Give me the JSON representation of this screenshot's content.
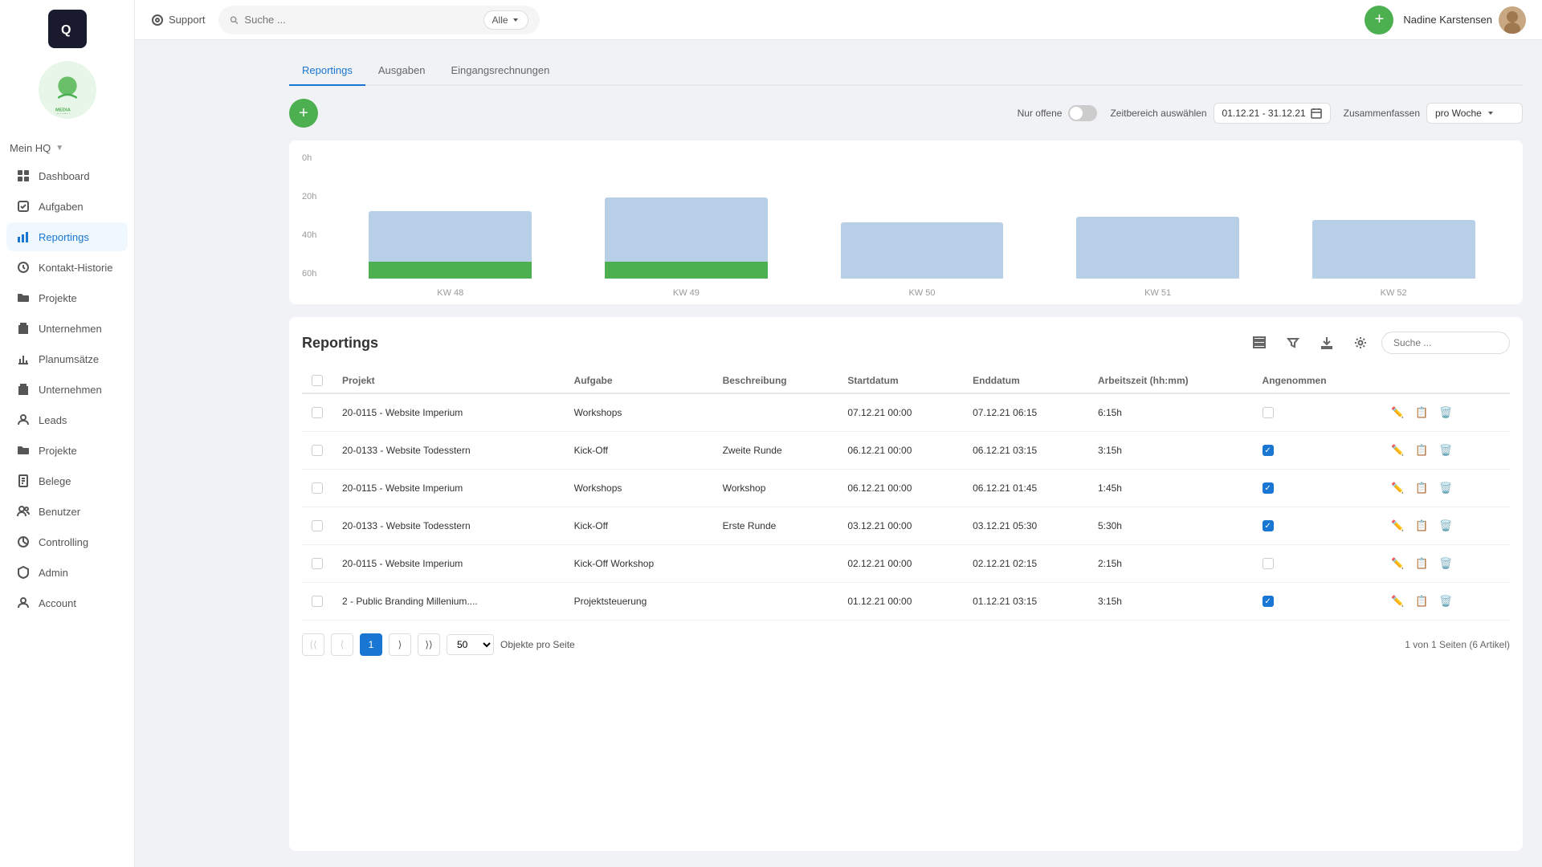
{
  "app": {
    "logo_text": "Q"
  },
  "topbar": {
    "support_label": "Support",
    "search_placeholder": "Suche ...",
    "search_filter_label": "Alle",
    "add_btn_label": "+",
    "user_name": "Nadine Karstensen"
  },
  "sidebar": {
    "mein_hq": "Mein HQ",
    "items": [
      {
        "id": "dashboard",
        "label": "Dashboard",
        "icon": "grid"
      },
      {
        "id": "aufgaben",
        "label": "Aufgaben",
        "icon": "check"
      },
      {
        "id": "reportings",
        "label": "Reportings",
        "icon": "chart",
        "active": true
      },
      {
        "id": "kontakt-historie",
        "label": "Kontakt-Historie",
        "icon": "clock"
      },
      {
        "id": "projekte1",
        "label": "Projekte",
        "icon": "folder"
      },
      {
        "id": "unternehmen1",
        "label": "Unternehmen",
        "icon": "building"
      },
      {
        "id": "planumsatze",
        "label": "Planumsätze",
        "icon": "bar"
      },
      {
        "id": "unternehmen2",
        "label": "Unternehmen",
        "icon": "building2"
      },
      {
        "id": "leads",
        "label": "Leads",
        "icon": "user"
      },
      {
        "id": "projekte2",
        "label": "Projekte",
        "icon": "folder2"
      },
      {
        "id": "belege",
        "label": "Belege",
        "icon": "file"
      },
      {
        "id": "benutzer",
        "label": "Benutzer",
        "icon": "users"
      },
      {
        "id": "controlling",
        "label": "Controlling",
        "icon": "pie"
      },
      {
        "id": "admin",
        "label": "Admin",
        "icon": "shield"
      },
      {
        "id": "account",
        "label": "Account",
        "icon": "person"
      }
    ]
  },
  "tabs": [
    {
      "id": "reportings",
      "label": "Reportings",
      "active": true
    },
    {
      "id": "ausgaben",
      "label": "Ausgaben"
    },
    {
      "id": "eingangsrechnungen",
      "label": "Eingangsrechnungen"
    }
  ],
  "chart": {
    "add_btn_label": "+",
    "nur_offene_label": "Nur offene",
    "zeitbereich_label": "Zeitbereich auswählen",
    "date_value": "01.12.21 - 31.12.21",
    "zusammenfassen_label": "Zusammenfassen",
    "week_option": "pro Woche",
    "y_labels": [
      "60h",
      "40h",
      "20h",
      "0h"
    ],
    "weeks": [
      {
        "label": "KW 48",
        "total_pct": 60,
        "active_pct": 15
      },
      {
        "label": "KW 49",
        "total_pct": 72,
        "active_pct": 15
      },
      {
        "label": "KW 50",
        "total_pct": 50,
        "active_pct": 0
      },
      {
        "label": "KW 51",
        "total_pct": 55,
        "active_pct": 0
      },
      {
        "label": "KW 52",
        "total_pct": 52,
        "active_pct": 0
      }
    ]
  },
  "table": {
    "title": "Reportings",
    "search_placeholder": "Suche ...",
    "columns": [
      "Projekt",
      "Aufgabe",
      "Beschreibung",
      "Startdatum",
      "Enddatum",
      "Arbeitszeit (hh:mm)",
      "Angenommen"
    ],
    "rows": [
      {
        "id": 1,
        "projekt": "20-0115 - Website Imperium",
        "aufgabe": "Workshops",
        "beschreibung": "",
        "startdatum": "07.12.21 00:00",
        "enddatum": "07.12.21 06:15",
        "arbeitszeit": "6:15h",
        "angenommen": false,
        "checked": false
      },
      {
        "id": 2,
        "projekt": "20-0133 - Website Todesstern",
        "aufgabe": "Kick-Off",
        "beschreibung": "Zweite Runde",
        "startdatum": "06.12.21 00:00",
        "enddatum": "06.12.21 03:15",
        "arbeitszeit": "3:15h",
        "angenommen": true,
        "checked": false
      },
      {
        "id": 3,
        "projekt": "20-0115 - Website Imperium",
        "aufgabe": "Workshops",
        "beschreibung": "Workshop",
        "startdatum": "06.12.21 00:00",
        "enddatum": "06.12.21 01:45",
        "arbeitszeit": "1:45h",
        "angenommen": true,
        "checked": false
      },
      {
        "id": 4,
        "projekt": "20-0133 - Website Todesstern",
        "aufgabe": "Kick-Off",
        "beschreibung": "Erste Runde",
        "startdatum": "03.12.21 00:00",
        "enddatum": "03.12.21 05:30",
        "arbeitszeit": "5:30h",
        "angenommen": true,
        "checked": false
      },
      {
        "id": 5,
        "projekt": "20-0115 - Website Imperium",
        "aufgabe": "Kick-Off Workshop",
        "beschreibung": "",
        "startdatum": "02.12.21 00:00",
        "enddatum": "02.12.21 02:15",
        "arbeitszeit": "2:15h",
        "angenommen": false,
        "checked": false
      },
      {
        "id": 6,
        "projekt": "2 - Public Branding Millenium....",
        "aufgabe": "Projektsteuerung",
        "beschreibung": "",
        "startdatum": "01.12.21 00:00",
        "enddatum": "01.12.21 03:15",
        "arbeitszeit": "3:15h",
        "angenommen": true,
        "checked": false
      }
    ],
    "pagination": {
      "current_page": 1,
      "per_page": "50",
      "info": "1 von 1 Seiten (6 Artikel)"
    }
  }
}
